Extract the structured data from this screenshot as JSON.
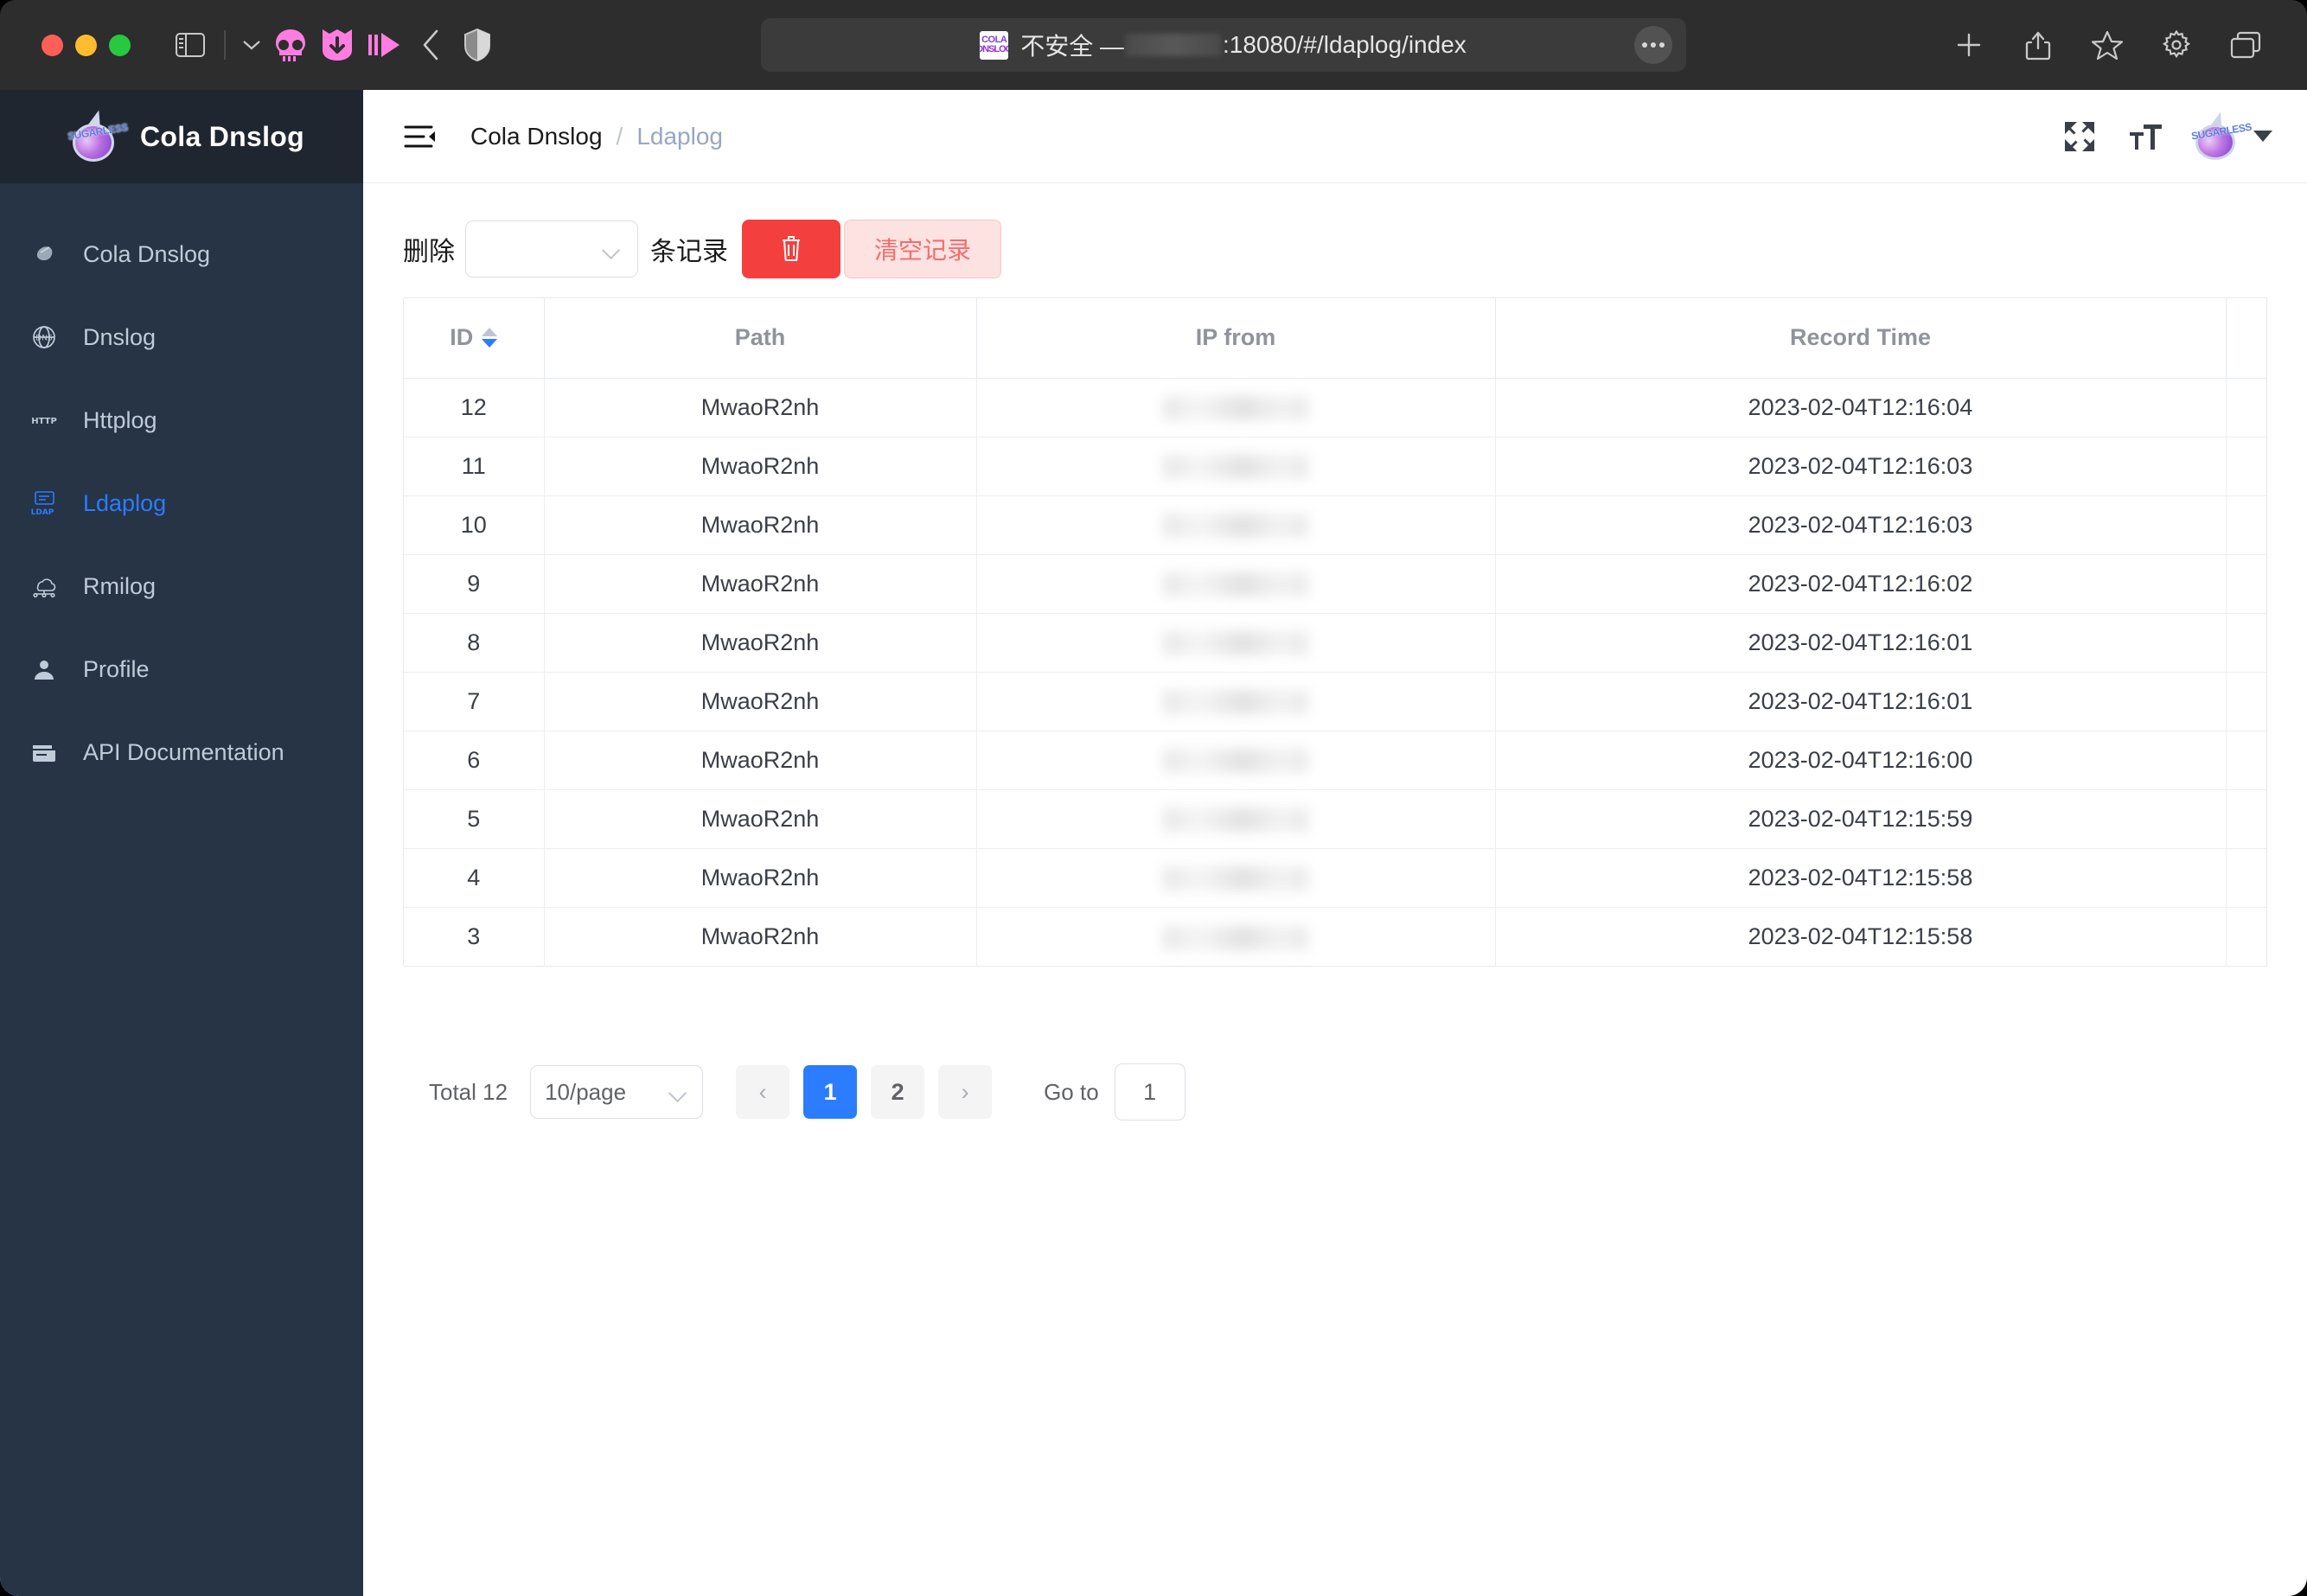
{
  "browser": {
    "url_prefix": "不安全 — ",
    "url_suffix": ":18080/#/ldaplog/index",
    "favicon_line1": "COLA",
    "favicon_line2": "DNSLOG",
    "left_icons": [
      "sidebar-toggle-icon",
      "sidebar-dropdown-caret-icon",
      "extension-skull-icon",
      "extension-download-icon",
      "extension-play-icon",
      "back-icon",
      "shield-icon"
    ],
    "right_icons": [
      "new-tab-icon",
      "share-icon",
      "bookmark-star-icon",
      "settings-gear-icon",
      "tab-overview-icon"
    ],
    "more_icon": "ellipsis-icon"
  },
  "sidebar": {
    "brand": "Cola Dnslog",
    "brand_logo_word": "SUGARLESS",
    "items": [
      {
        "label": "Cola Dnslog",
        "icon": "drop-icon",
        "active": false
      },
      {
        "label": "Dnslog",
        "icon": "dns-globe-icon",
        "active": false
      },
      {
        "label": "Httplog",
        "icon": "http-icon",
        "active": false
      },
      {
        "label": "Ldaplog",
        "icon": "ldap-icon",
        "active": true
      },
      {
        "label": "Rmilog",
        "icon": "rmi-cloud-icon",
        "active": false
      },
      {
        "label": "Profile",
        "icon": "user-icon",
        "active": false
      },
      {
        "label": "API Documentation",
        "icon": "document-icon",
        "active": false
      }
    ]
  },
  "topbar": {
    "hamburger_icon": "menu-fold-icon",
    "breadcrumb_root": "Cola Dnslog",
    "breadcrumb_sep": "/",
    "breadcrumb_current": "Ldaplog",
    "fullscreen_icon": "fullscreen-icon",
    "fontsize_icon": "font-size-icon",
    "avatar_word": "SUGARLESS",
    "avatar_caret_icon": "chevron-down-icon"
  },
  "toolbar": {
    "delete_label": "删除",
    "count_value": "",
    "count_placeholder": "",
    "records_label": "条记录",
    "delete_button_icon": "trash-icon",
    "clear_button_label": "清空记录",
    "delete_button_color": "#f43f3f",
    "clear_button_color": "#fde2e2",
    "clear_button_text_color": "#f56c6c"
  },
  "table": {
    "columns": [
      "ID",
      "Path",
      "IP from",
      "Record Time"
    ],
    "sort_column": "ID",
    "sort_direction": "descending",
    "rows": [
      {
        "id": "12",
        "path": "MwaoR2nh",
        "ip": "",
        "time": "2023-02-04T12:16:04"
      },
      {
        "id": "11",
        "path": "MwaoR2nh",
        "ip": "",
        "time": "2023-02-04T12:16:03"
      },
      {
        "id": "10",
        "path": "MwaoR2nh",
        "ip": "",
        "time": "2023-02-04T12:16:03"
      },
      {
        "id": "9",
        "path": "MwaoR2nh",
        "ip": "",
        "time": "2023-02-04T12:16:02"
      },
      {
        "id": "8",
        "path": "MwaoR2nh",
        "ip": "",
        "time": "2023-02-04T12:16:01"
      },
      {
        "id": "7",
        "path": "MwaoR2nh",
        "ip": "",
        "time": "2023-02-04T12:16:01"
      },
      {
        "id": "6",
        "path": "MwaoR2nh",
        "ip": "",
        "time": "2023-02-04T12:16:00"
      },
      {
        "id": "5",
        "path": "MwaoR2nh",
        "ip": "",
        "time": "2023-02-04T12:15:59"
      },
      {
        "id": "4",
        "path": "MwaoR2nh",
        "ip": "",
        "time": "2023-02-04T12:15:58"
      },
      {
        "id": "3",
        "path": "MwaoR2nh",
        "ip": "",
        "time": "2023-02-04T12:15:58"
      }
    ]
  },
  "pagination": {
    "total_label": "Total 12",
    "page_size": "10/page",
    "prev_icon": "chevron-left-icon",
    "next_icon": "chevron-right-icon",
    "pages": [
      "1",
      "2"
    ],
    "current_page": "1",
    "goto_label": "Go to",
    "goto_value": "1",
    "active_color": "#2b7cff"
  }
}
